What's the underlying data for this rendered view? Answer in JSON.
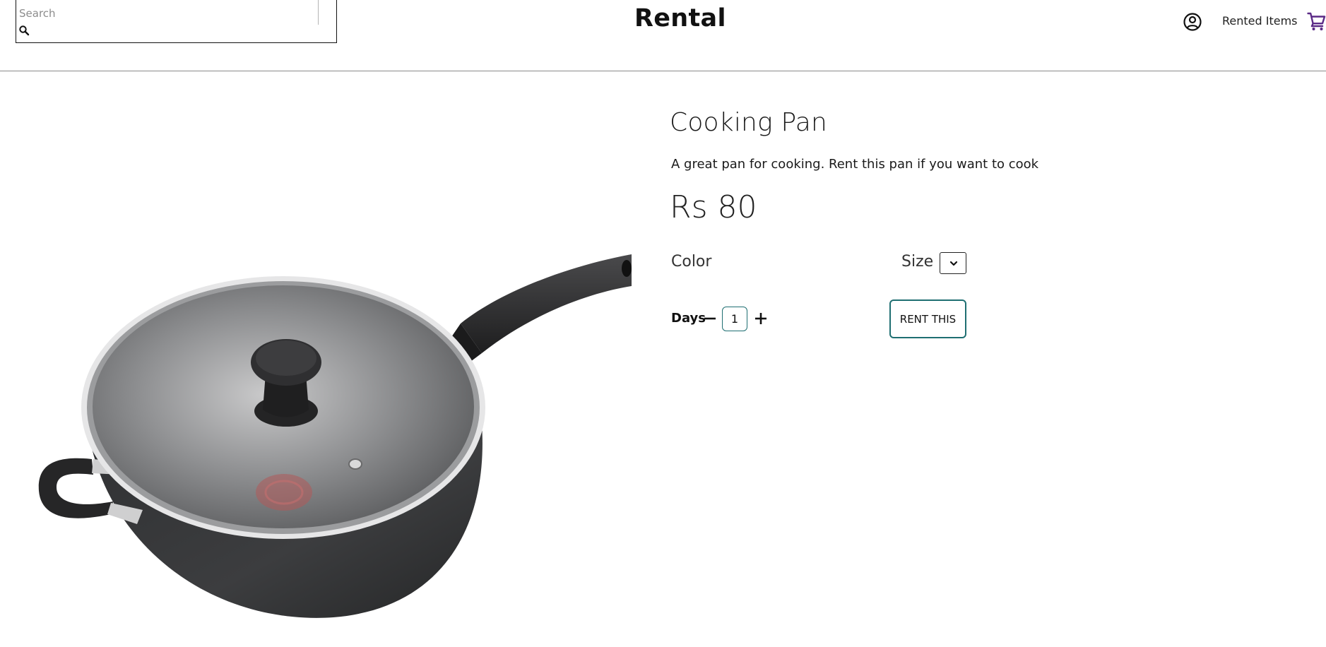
{
  "header": {
    "search": {
      "placeholder": "Search",
      "value": ""
    },
    "brand": "Rental",
    "rented_items_label": "Rented Items",
    "accent_color": "#5b2a86"
  },
  "product": {
    "title": "Cooking Pan",
    "description": "A great pan for cooking. Rent this pan if you want to cook",
    "price": "Rs 80",
    "color_label": "Color",
    "size_label": "Size",
    "days_label": "Days",
    "days_value": "1",
    "rent_button_label": "RENT THIS",
    "button_border_color": "#1f6f72"
  },
  "icons": {
    "search": "search-icon",
    "account": "account-circle-icon",
    "cart": "cart-icon",
    "minus": "minus-icon",
    "plus": "plus-icon",
    "dropdown": "chevron-down-icon"
  }
}
